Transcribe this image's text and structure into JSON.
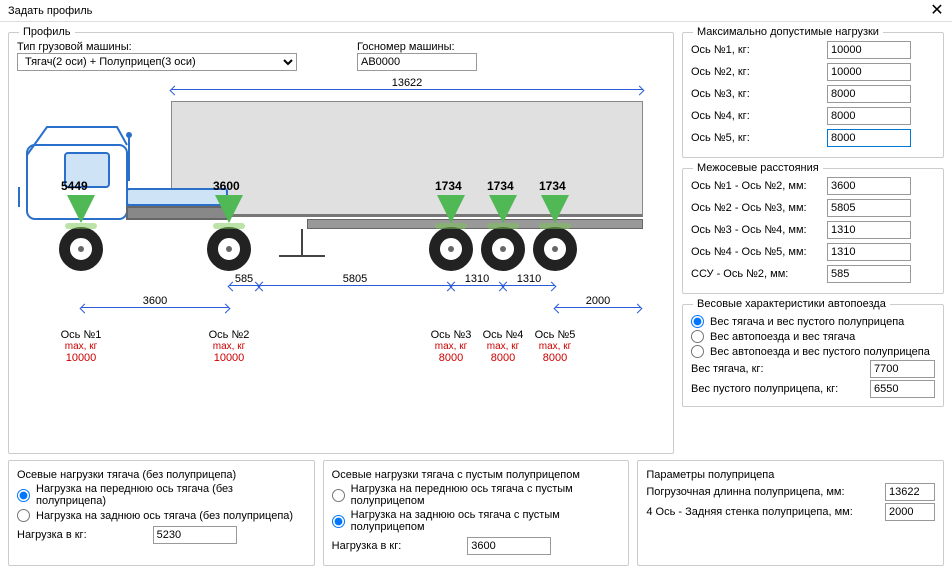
{
  "window_title": "Задать профиль",
  "profile_group": "Профиль",
  "truck_type_label": "Тип грузовой машины:",
  "truck_type_value": "Тягач(2 оси) + Полуприцеп(3 оси)",
  "license_label": "Госномер машины:",
  "license_value": "AB0000",
  "max_loads_group": "Максимально допустимые нагрузки",
  "max_loads": [
    {
      "label": "Ось №1, кг:",
      "value": "10000"
    },
    {
      "label": "Ось №2, кг:",
      "value": "10000"
    },
    {
      "label": "Ось №3, кг:",
      "value": "8000"
    },
    {
      "label": "Ось №4, кг:",
      "value": "8000"
    },
    {
      "label": "Ось №5, кг:",
      "value": "8000"
    }
  ],
  "interaxle_group": "Межосевые расстояния",
  "interaxle": [
    {
      "label": "Ось №1 - Ось №2, мм:",
      "value": "3600"
    },
    {
      "label": "Ось №2 - Ось №3, мм:",
      "value": "5805"
    },
    {
      "label": "Ось №3 - Ось №4, мм:",
      "value": "1310"
    },
    {
      "label": "Ось №4 - Ось №5, мм:",
      "value": "1310"
    },
    {
      "label": "ССУ - Ось №2, мм:",
      "value": "585"
    }
  ],
  "weight_group": "Весовые характеристики автопоезда",
  "weight_radios": [
    "Вес тягача и вес пустого полуприцепа",
    "Вес автопоезда и вес тягача",
    "Вес автопоезда и вес пустого полуприцепа"
  ],
  "weight_tractor_label": "Вес тягача, кг:",
  "weight_tractor": "7700",
  "weight_trailer_label": "Вес пустого полуприцепа, кг:",
  "weight_trailer": "6550",
  "trailer_params_group": "Параметры полуприцепа",
  "trailer_len_label": "Погрузочная длинна полуприцепа, мм:",
  "trailer_len": "13622",
  "trailer_back_label": "4 Ось - Задняя стенка полуприцепа, мм:",
  "trailer_back": "2000",
  "tractor_axle_group": "Осевые нагрузки тягача (без полуприцепа)",
  "tractor_axle_radios": [
    "Нагрузка на переднюю ось тягача (без полуприцепа)",
    "Нагрузка на заднюю ось тягача (без полуприцепа)"
  ],
  "tractor_axle_load_label": "Нагрузка в кг:",
  "tractor_axle_load": "5230",
  "combo_axle_group": "Осевые нагрузки тягача с пустым полуприцепом",
  "combo_axle_radios": [
    "Нагрузка на переднюю ось тягача с пустым полуприцепом",
    "Нагрузка на заднюю ось тягача с пустым полуприцепом"
  ],
  "combo_axle_load_label": "Нагрузка в кг:",
  "combo_axle_load": "3600",
  "diagram": {
    "total_len": "13622",
    "dims": [
      "3600",
      "585",
      "5805",
      "1310",
      "1310",
      "2000"
    ],
    "loads": [
      "5449",
      "3600",
      "1734",
      "1734",
      "1734"
    ],
    "axles": [
      {
        "name": "Ось №1",
        "max": "max, кг",
        "val": "10000"
      },
      {
        "name": "Ось №2",
        "max": "max, кг",
        "val": "10000"
      },
      {
        "name": "Ось №3",
        "max": "max, кг",
        "val": "8000"
      },
      {
        "name": "Ось №4",
        "max": "max, кг",
        "val": "8000"
      },
      {
        "name": "Ось №5",
        "max": "max, кг",
        "val": "8000"
      }
    ]
  }
}
